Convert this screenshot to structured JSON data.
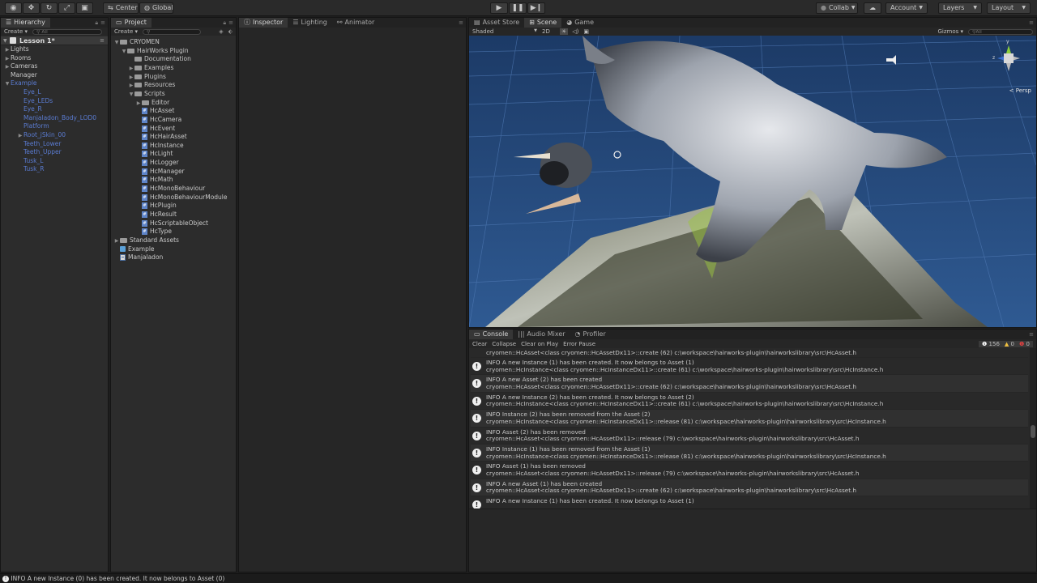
{
  "toolbar": {
    "tools": [
      "hand-tool",
      "move-tool",
      "rotate-tool",
      "scale-tool",
      "rect-tool"
    ],
    "pivot_label": "Center",
    "space_label": "Global",
    "collab_label": "Collab",
    "account_label": "Account",
    "layers_label": "Layers",
    "layout_label": "Layout"
  },
  "hierarchy": {
    "tab": "Hierarchy",
    "create_label": "Create",
    "search_placeholder": "All",
    "scene_name": "Lesson 1*",
    "items": [
      {
        "label": "Lights",
        "indent": 1,
        "arrow": "right",
        "blue": false
      },
      {
        "label": "Rooms",
        "indent": 1,
        "arrow": "right",
        "blue": false
      },
      {
        "label": "Cameras",
        "indent": 1,
        "arrow": "right",
        "blue": false
      },
      {
        "label": "Manager",
        "indent": 1,
        "arrow": "",
        "blue": false
      },
      {
        "label": "Example",
        "indent": 1,
        "arrow": "down",
        "blue": true
      },
      {
        "label": "Eye_L",
        "indent": 2,
        "arrow": "",
        "blue": true
      },
      {
        "label": "Eye_LEDs",
        "indent": 2,
        "arrow": "",
        "blue": true
      },
      {
        "label": "Eye_R",
        "indent": 2,
        "arrow": "",
        "blue": true
      },
      {
        "label": "Manjaladon_Body_LOD0",
        "indent": 2,
        "arrow": "",
        "blue": true
      },
      {
        "label": "Platform",
        "indent": 2,
        "arrow": "",
        "blue": true
      },
      {
        "label": "Root_jSkin_00",
        "indent": 2,
        "arrow": "right",
        "blue": true
      },
      {
        "label": "Teeth_Lower",
        "indent": 2,
        "arrow": "",
        "blue": true
      },
      {
        "label": "Teeth_Upper",
        "indent": 2,
        "arrow": "",
        "blue": true
      },
      {
        "label": "Tusk_L",
        "indent": 2,
        "arrow": "",
        "blue": true
      },
      {
        "label": "Tusk_R",
        "indent": 2,
        "arrow": "",
        "blue": true
      }
    ]
  },
  "project": {
    "tab": "Project",
    "create_label": "Create",
    "items": [
      {
        "label": "CRYOMEN",
        "indent": 0,
        "arrow": "down",
        "icon": "folder"
      },
      {
        "label": "HairWorks Plugin",
        "indent": 1,
        "arrow": "down",
        "icon": "folder"
      },
      {
        "label": "Documentation",
        "indent": 2,
        "arrow": "",
        "icon": "folder"
      },
      {
        "label": "Examples",
        "indent": 2,
        "arrow": "right",
        "icon": "folder"
      },
      {
        "label": "Plugins",
        "indent": 2,
        "arrow": "right",
        "icon": "folder"
      },
      {
        "label": "Resources",
        "indent": 2,
        "arrow": "right",
        "icon": "folder"
      },
      {
        "label": "Scripts",
        "indent": 2,
        "arrow": "down",
        "icon": "folder"
      },
      {
        "label": "Editor",
        "indent": 3,
        "arrow": "right",
        "icon": "folder"
      },
      {
        "label": "HcAsset",
        "indent": 3,
        "arrow": "",
        "icon": "script"
      },
      {
        "label": "HcCamera",
        "indent": 3,
        "arrow": "",
        "icon": "script"
      },
      {
        "label": "HcEvent",
        "indent": 3,
        "arrow": "",
        "icon": "script"
      },
      {
        "label": "HcHairAsset",
        "indent": 3,
        "arrow": "",
        "icon": "script"
      },
      {
        "label": "HcInstance",
        "indent": 3,
        "arrow": "",
        "icon": "script"
      },
      {
        "label": "HcLight",
        "indent": 3,
        "arrow": "",
        "icon": "script"
      },
      {
        "label": "HcLogger",
        "indent": 3,
        "arrow": "",
        "icon": "script"
      },
      {
        "label": "HcManager",
        "indent": 3,
        "arrow": "",
        "icon": "script"
      },
      {
        "label": "HcMath",
        "indent": 3,
        "arrow": "",
        "icon": "script"
      },
      {
        "label": "HcMonoBehaviour",
        "indent": 3,
        "arrow": "",
        "icon": "script"
      },
      {
        "label": "HcMonoBehaviourModule",
        "indent": 3,
        "arrow": "",
        "icon": "script"
      },
      {
        "label": "HcPlugin",
        "indent": 3,
        "arrow": "",
        "icon": "script"
      },
      {
        "label": "HcResult",
        "indent": 3,
        "arrow": "",
        "icon": "script"
      },
      {
        "label": "HcScriptableObject",
        "indent": 3,
        "arrow": "",
        "icon": "script"
      },
      {
        "label": "HcType",
        "indent": 3,
        "arrow": "",
        "icon": "script"
      },
      {
        "label": "Standard Assets",
        "indent": 0,
        "arrow": "right",
        "icon": "folder"
      },
      {
        "label": "Example",
        "indent": 0,
        "arrow": "",
        "icon": "prefab"
      },
      {
        "label": "Manjaladon",
        "indent": 0,
        "arrow": "",
        "icon": "scene"
      }
    ]
  },
  "inspector_tabs": [
    "Inspector",
    "Lighting",
    "Animator"
  ],
  "scene": {
    "tabs": [
      "Asset Store",
      "Scene",
      "Game"
    ],
    "shading_mode": "Shaded",
    "mode_2d": "2D",
    "gizmos_label": "Gizmos",
    "search_placeholder": "All",
    "persp_label": "Persp",
    "gizmo_axes": [
      "y",
      "z"
    ]
  },
  "console": {
    "tabs": [
      "Console",
      "Audio Mixer",
      "Profiler"
    ],
    "buttons": [
      "Clear",
      "Collapse",
      "Clear on Play",
      "Error Pause"
    ],
    "info_count": "156",
    "warning_count": "0",
    "error_count": "0",
    "partial_top": "cryomen::HcAsset<class cryomen::HcAssetDx11>::create (62) c:\\workspace\\hairworks-plugin\\hairworkslibrary\\src\\HcAsset.h",
    "entries": [
      {
        "line1": "INFO A new Instance (1) has been created. It now belongs to Asset (1)",
        "line2": "cryomen::HcInstance<class cryomen::HcInstanceDx11>::create (61) c:\\workspace\\hairworks-plugin\\hairworkslibrary\\src\\HcInstance.h"
      },
      {
        "line1": "INFO A new Asset (2) has been created",
        "line2": "cryomen::HcAsset<class cryomen::HcAssetDx11>::create (62) c:\\workspace\\hairworks-plugin\\hairworkslibrary\\src\\HcAsset.h"
      },
      {
        "line1": "INFO A new Instance (2) has been created. It now belongs to Asset (2)",
        "line2": "cryomen::HcInstance<class cryomen::HcInstanceDx11>::create (61) c:\\workspace\\hairworks-plugin\\hairworkslibrary\\src\\HcInstance.h"
      },
      {
        "line1": "INFO Instance (2) has been removed from the Asset (2)",
        "line2": "cryomen::HcInstance<class cryomen::HcInstanceDx11>::release (81) c:\\workspace\\hairworks-plugin\\hairworkslibrary\\src\\HcInstance.h"
      },
      {
        "line1": "INFO Asset (2) has been removed",
        "line2": "cryomen::HcAsset<class cryomen::HcAssetDx11>::release (79) c:\\workspace\\hairworks-plugin\\hairworkslibrary\\src\\HcAsset.h"
      },
      {
        "line1": "INFO Instance (1) has been removed from the Asset (1)",
        "line2": "cryomen::HcInstance<class cryomen::HcInstanceDx11>::release (81) c:\\workspace\\hairworks-plugin\\hairworkslibrary\\src\\HcInstance.h"
      },
      {
        "line1": "INFO Asset (1) has been removed",
        "line2": "cryomen::HcAsset<class cryomen::HcAssetDx11>::release (79) c:\\workspace\\hairworks-plugin\\hairworkslibrary\\src\\HcAsset.h"
      },
      {
        "line1": "INFO A new Asset (1) has been created",
        "line2": "cryomen::HcAsset<class cryomen::HcAssetDx11>::create (62) c:\\workspace\\hairworks-plugin\\hairworkslibrary\\src\\HcAsset.h"
      },
      {
        "line1": "INFO A new Instance (1) has been created. It now belongs to Asset (1)",
        "line2": ""
      }
    ]
  },
  "status_bar": {
    "message": "INFO A new Instance (0) has been created. It now belongs to Asset (0)"
  }
}
